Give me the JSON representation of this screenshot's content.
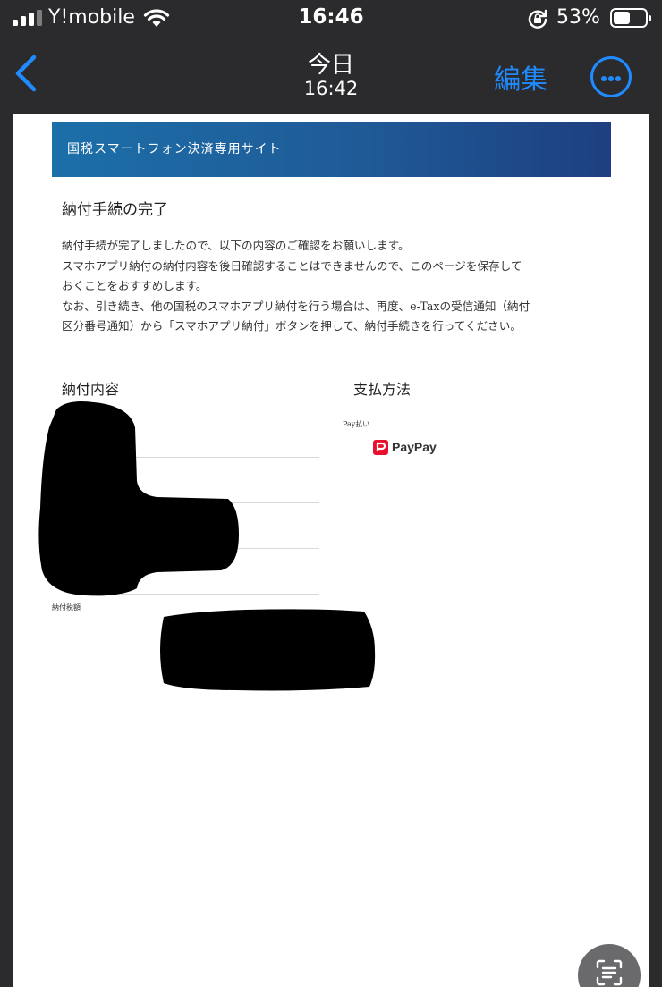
{
  "status_bar": {
    "carrier": "Y!mobile",
    "time": "16:46",
    "battery_percent": "53%",
    "battery_level": 0.53
  },
  "nav": {
    "title": "今日",
    "subtitle": "16:42",
    "edit_label": "編集"
  },
  "page": {
    "site_name": "国税スマートフォン決済専用サイト",
    "title": "納付手続の完了",
    "body_lines": [
      "納付手続が完了しましたので、以下の内容のご確認をお願いします。",
      "スマホアプリ納付の納付内容を後日確認することはできませんので、このページを保存して",
      "おくことをおすすめします。",
      "なお、引き続き、他の国税のスマホアプリ納付を行う場合は、再度、e-Taxの受信通知（納付",
      "区分番号通知）から「スマホアプリ納付」ボタンを押して、納付手続きを行ってください。"
    ],
    "payment_details_heading": "納付内容",
    "payment_method_heading": "支払方法",
    "tax_amount_label": "納付税額",
    "payment_label": "Pay払い",
    "paypay_brand": "PayPay",
    "accent_color": "#1f8bff"
  }
}
